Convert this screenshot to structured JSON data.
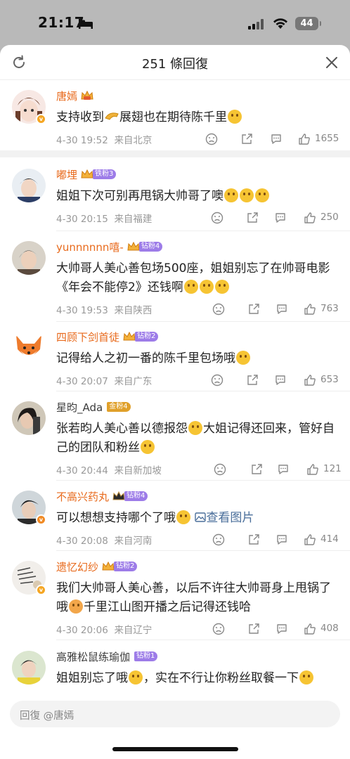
{
  "status_bar": {
    "time": "21:17",
    "battery": "44"
  },
  "header": {
    "title": "251 條回復"
  },
  "colors": {
    "vip_orange": "#e86a1c",
    "link_blue": "#4a6e9a",
    "fan_purple": "#9d7ce8",
    "fan_gold": "#e0a02a"
  },
  "comments": [
    {
      "user": "唐嫣",
      "text": "支持收到",
      "text2": "展翅也在期待陈千里",
      "time": "4-30 19:52",
      "location": "来自北京",
      "likes": "1655"
    },
    {
      "user": "嘟埋",
      "badge": "铁粉3",
      "text": "姐姐下次可别再甩锅大帅哥了噢",
      "time": "4-30 20:15",
      "location": "来自福建",
      "likes": "250"
    },
    {
      "user": "yunnnnnn嘻-",
      "badge": "钻粉4",
      "text": "大帅哥人美心善包场500座，姐姐别忘了在帅哥电影《年会不能停2》还钱啊",
      "time": "4-30 19:53",
      "location": "来自陕西",
      "likes": "763"
    },
    {
      "user": "四顾下剑首徒",
      "badge": "钻粉2",
      "text": "记得给人之初一番的陈千里包场哦",
      "time": "4-30 20:07",
      "location": "来自广东",
      "likes": "653"
    },
    {
      "user": "星昀_Ada",
      "badge": "金粉4",
      "text": "张若昀人美心善以德报怨",
      "text2": "大姐记得还回来，管好自己的团队和粉丝",
      "time": "4-30 20:44",
      "location": "来自新加坡",
      "likes": "121"
    },
    {
      "user": "不高兴药丸",
      "badge": "钻粉4",
      "text": "可以想想支持哪个了哦",
      "link": "查看图片",
      "time": "4-30 20:08",
      "location": "来自河南",
      "likes": "414"
    },
    {
      "user": "遗忆幻纱",
      "badge": "钻粉2",
      "text": "我们大帅哥人美心善，以后不许往大帅哥身上甩锅了哦",
      "text2": "千里江山图开播之后记得还钱哈",
      "time": "4-30 20:06",
      "location": "来自辽宁",
      "likes": "408"
    },
    {
      "user": "高雅松鼠练瑜伽",
      "badge": "钻粉1",
      "text": "姐姐别忘了哦",
      "text2": "，实在不行让你粉丝取餐一下"
    }
  ],
  "reply_box": {
    "placeholder": "回復 @唐嫣"
  }
}
